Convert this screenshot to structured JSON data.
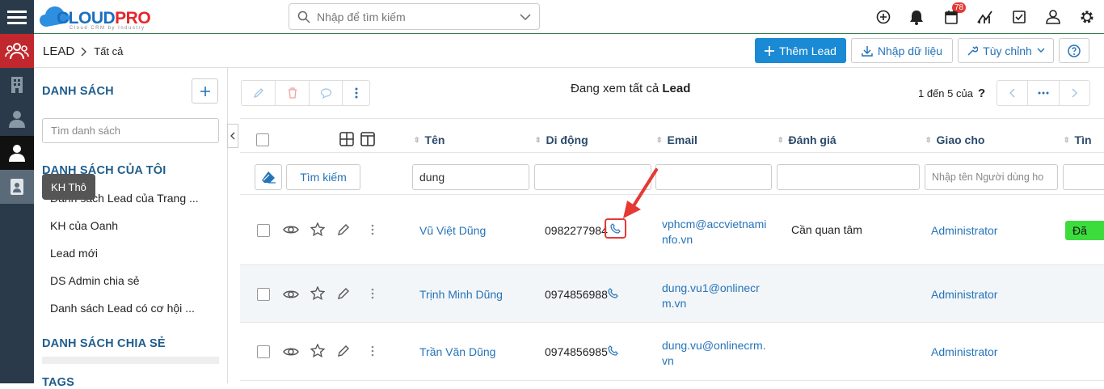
{
  "app": {
    "logo_text_1": "CLOUD",
    "logo_text_2": "PRO",
    "logo_tagline": "Cloud CRM by Industry"
  },
  "search": {
    "placeholder": "Nhập để tìm kiếm"
  },
  "notifications": {
    "count": "78"
  },
  "rail": {
    "tooltip": "KH Thô"
  },
  "breadcrumb": {
    "module": "LEAD",
    "current": "Tất cả"
  },
  "header_buttons": {
    "add": "Thêm Lead",
    "import": "Nhập dữ liệu",
    "customize": "Tùy chỉnh"
  },
  "sidebar": {
    "list_title": "DANH SÁCH",
    "search_placeholder": "Tìm danh sách",
    "my_lists_title": "DANH SÁCH CỦA TÔI",
    "items": [
      "Danh sách Lead của Trang ...",
      "KH của Oanh",
      "Lead mới",
      "DS Admin chia sẻ",
      "Danh sách Lead có cơ hội ..."
    ],
    "shared_title": "DANH SÁCH CHIA SẺ",
    "tags_title": "TAGS"
  },
  "view": {
    "label_prefix": "Đang xem tất cả",
    "label_bold": "Lead",
    "pagination": "1 đến 5 của",
    "pagination_q": "?"
  },
  "table": {
    "columns": [
      "Tên",
      "Di động",
      "Email",
      "Đánh giá",
      "Giao cho",
      "Tìn"
    ],
    "search_btn": "Tìm kiếm",
    "filter_name": "dung",
    "filter_assignee_placeholder": "Nhập tên Người dùng ho",
    "rows": [
      {
        "name": "Vũ Việt Dũng",
        "mobile": "0982277984",
        "email_1": "vphcm@accvietnami",
        "email_2": "nfo.vn",
        "rating": "Cần quan tâm",
        "assigned": "Administrator",
        "status": "Đã"
      },
      {
        "name": "Trịnh Minh Dũng",
        "mobile": "0974856988",
        "email_1": "dung.vu1@onlinecr",
        "email_2": "m.vn",
        "rating": "",
        "assigned": "Administrator",
        "status": ""
      },
      {
        "name": "Trần Văn Dũng",
        "mobile": "0974856985",
        "email_1": "dung.vu@onlinecrm.",
        "email_2": "vn",
        "rating": "",
        "assigned": "Administrator",
        "status": ""
      }
    ]
  },
  "colors": {
    "accent": "#1a8ad4",
    "brand_red": "#e8262b",
    "rail": "#2b3a4a",
    "link": "#2573b8",
    "status_green": "#3ddc3d"
  }
}
